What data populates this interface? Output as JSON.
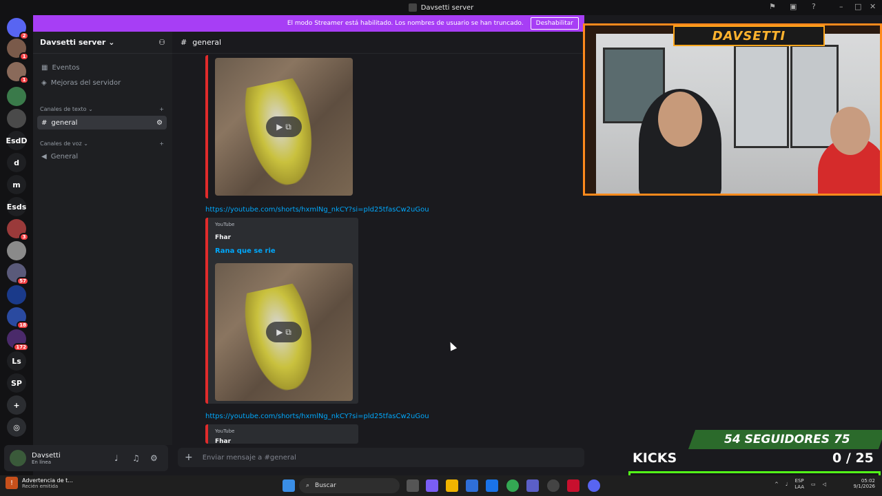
{
  "window": {
    "title": "Davsetti server"
  },
  "streamer_bar": {
    "message": "El modo Streamer está habilitado. Los nombres de usuario se han truncado.",
    "button": "Deshabilitar"
  },
  "servers": [
    {
      "label": "",
      "badge": "2"
    },
    {
      "label": "",
      "badge": "1"
    },
    {
      "label": "",
      "badge": "1"
    },
    {
      "label": "",
      "badge": ""
    },
    {
      "label": "",
      "badge": ""
    },
    {
      "label": "EsdD",
      "badge": ""
    },
    {
      "label": "d",
      "badge": ""
    },
    {
      "label": "m",
      "badge": ""
    },
    {
      "label": "Esds",
      "badge": ""
    },
    {
      "label": "",
      "badge": "3"
    },
    {
      "label": "",
      "badge": ""
    },
    {
      "label": "",
      "badge": "57"
    },
    {
      "label": "",
      "badge": ""
    },
    {
      "label": "",
      "badge": "18"
    },
    {
      "label": "",
      "badge": "172"
    },
    {
      "label": "Ls",
      "badge": ""
    },
    {
      "label": "SP",
      "badge": ""
    }
  ],
  "sidebar": {
    "server_name": "Davsetti server",
    "events": "Eventos",
    "boosts": "Mejoras del servidor",
    "text_category": "Canales de texto",
    "voice_category": "Canales de voz",
    "text_channel": "general",
    "voice_channel": "General"
  },
  "chat": {
    "channel": "general",
    "link": "https://youtube.com/shorts/hxmlNg_nkCY?si=pld25tfasCw2uGou",
    "embed_provider": "YouTube",
    "embed_author": "Fhar",
    "embed_title": "Rana que se rie",
    "embed_author_partial": "Fhar",
    "composer_placeholder": "Enviar mensaje a #general"
  },
  "user": {
    "name": "Davsetti",
    "status": "En línea"
  },
  "overlay": {
    "banner": "DAVSETTI",
    "followers": "54 SEGUIDORES 75",
    "kicks": "KICKS",
    "kick_count": "0 / 25"
  },
  "taskbar": {
    "notif_title": "Advertencia de t...",
    "notif_sub": "Recién emitida",
    "search": "Buscar",
    "lang_top": "ESP",
    "lang_bottom": "LAA",
    "time": "05:02",
    "date": "9/1/2026"
  },
  "colors": {
    "accent": "#a73ef5",
    "link": "#00a8fc",
    "embed_border": "#e02b2b",
    "kick_green": "#53fc18"
  }
}
